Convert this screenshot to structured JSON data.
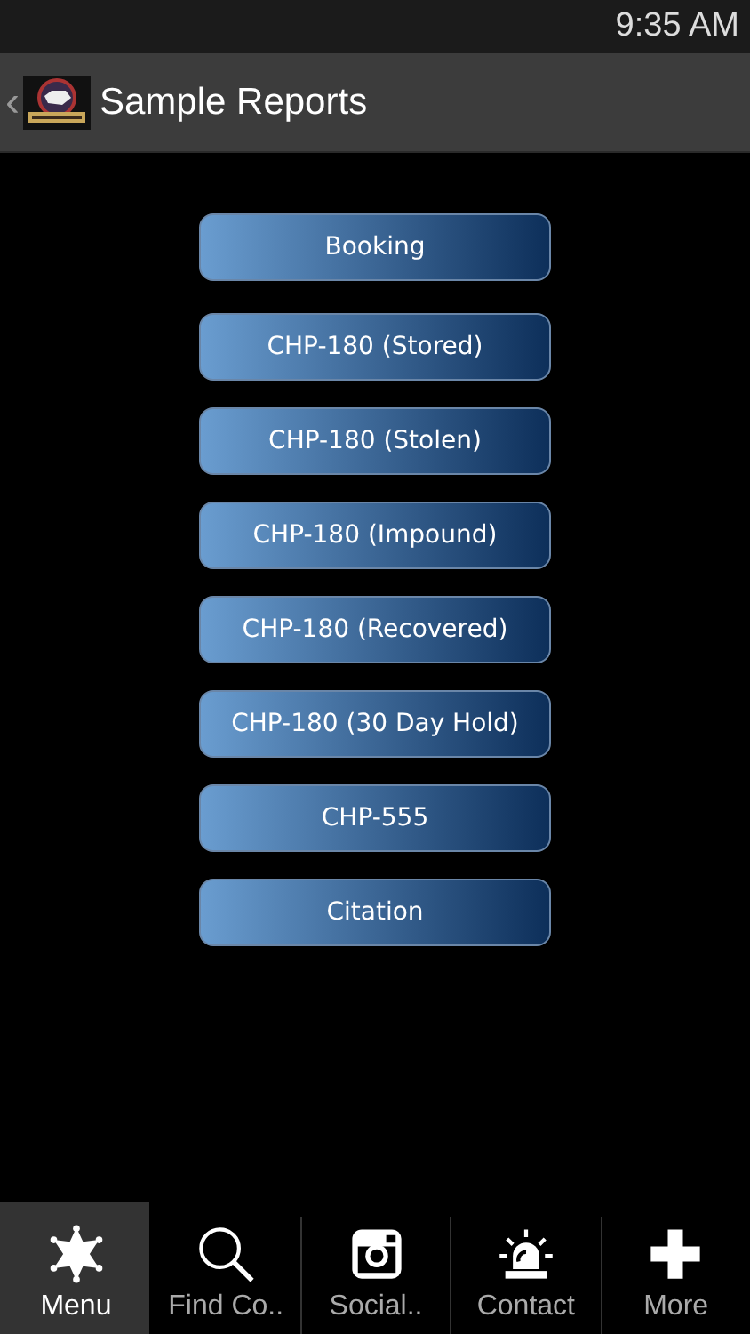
{
  "status_bar": {
    "time": "9:35 AM"
  },
  "action_bar": {
    "back": "‹",
    "title": "Sample Reports"
  },
  "buttons": [
    "Booking",
    "CHP-180 (Stored)",
    "CHP-180 (Stolen)",
    "CHP-180 (Impound)",
    "CHP-180 (Recovered)",
    "CHP-180 (30 Day Hold)",
    "CHP-555",
    "Citation"
  ],
  "tabs": [
    {
      "label": "Menu",
      "selected": true
    },
    {
      "label": "Find Co..",
      "selected": false
    },
    {
      "label": "Social..",
      "selected": false
    },
    {
      "label": "Contact",
      "selected": false
    },
    {
      "label": "More",
      "selected": false
    }
  ]
}
